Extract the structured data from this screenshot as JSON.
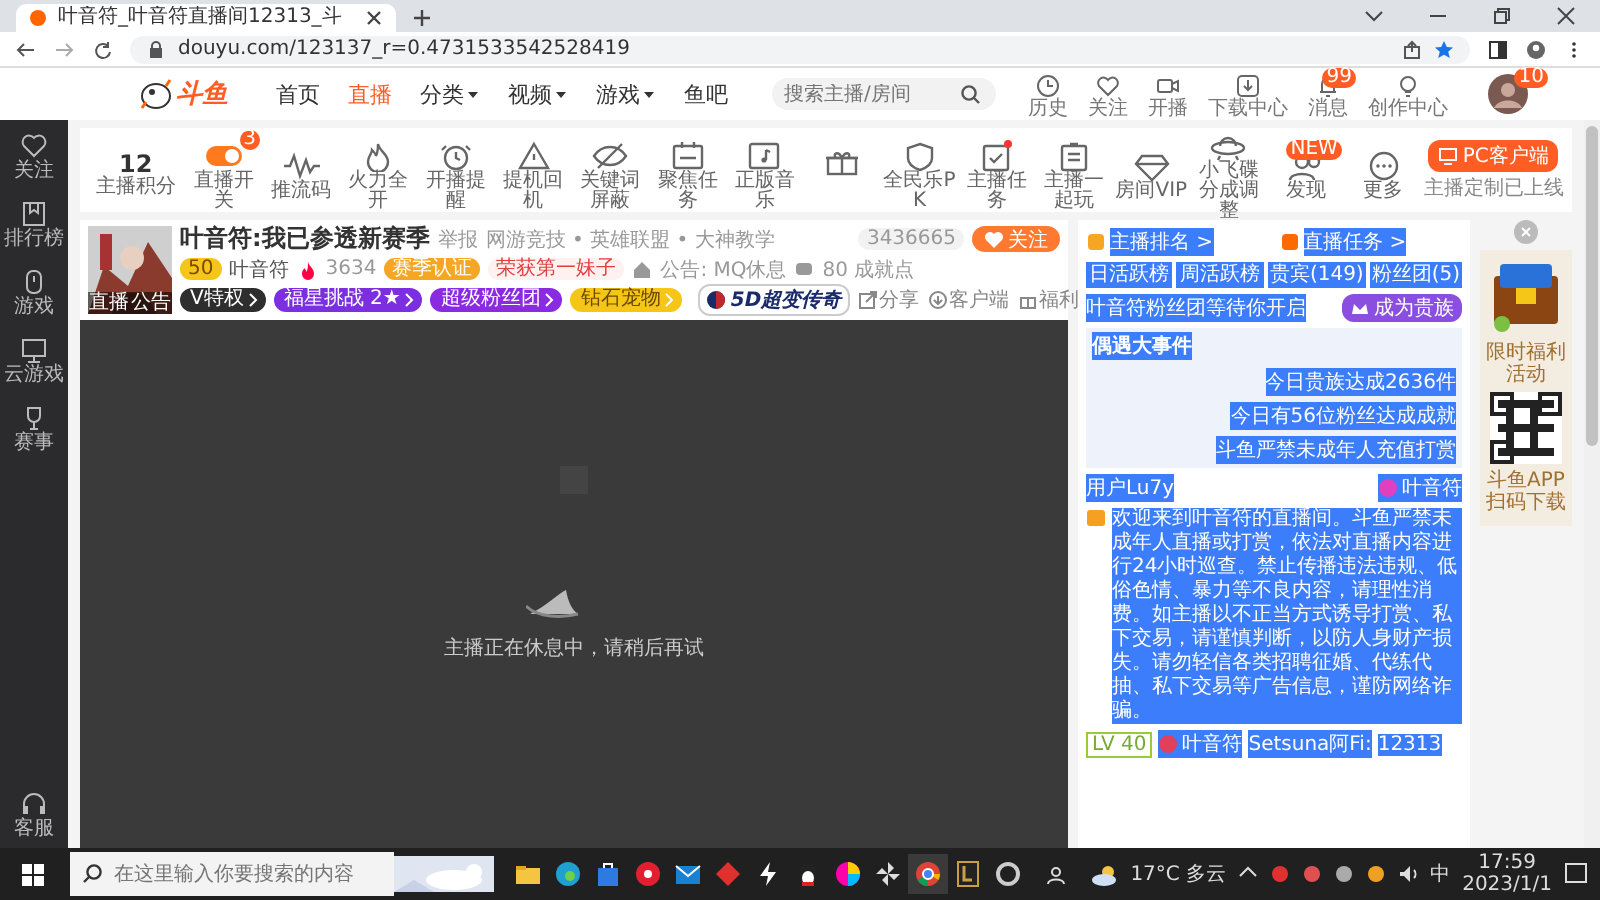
{
  "browser": {
    "tab_title": "叶音符_叶音符直播间12313_斗",
    "url": "douyu.com/123137_r=0.4731533542528419"
  },
  "site_nav": {
    "logo": "斗鱼",
    "items": [
      {
        "label": "首页",
        "selected": false,
        "dropdown": false
      },
      {
        "label": "直播",
        "selected": true,
        "dropdown": false
      },
      {
        "label": "分类",
        "selected": false,
        "dropdown": true
      },
      {
        "label": "视频",
        "selected": false,
        "dropdown": true
      },
      {
        "label": "游戏",
        "selected": false,
        "dropdown": true
      },
      {
        "label": "鱼吧",
        "selected": false,
        "dropdown": false
      }
    ],
    "search": {
      "placeholder": "搜索主播/房间"
    },
    "actions": [
      {
        "label": "历史"
      },
      {
        "label": "关注"
      },
      {
        "label": "开播"
      },
      {
        "label": "下载中心"
      },
      {
        "label": "消息",
        "badge": "99"
      },
      {
        "label": "创作中心"
      }
    ],
    "avatar_badge": "10"
  },
  "sidebar": {
    "items": [
      {
        "label": "关注"
      },
      {
        "label": "排行榜"
      },
      {
        "label": "游戏"
      },
      {
        "label": "云游戏"
      },
      {
        "label": "赛事"
      }
    ],
    "bottom": "客服"
  },
  "toolbar": {
    "score": "12",
    "score_label": "主播积分",
    "items": [
      {
        "kind": "labeled",
        "label": "直播开关",
        "badge": "3"
      },
      {
        "kind": "labeled",
        "label": "推流码"
      },
      {
        "kind": "labeled",
        "label": "火力全开"
      },
      {
        "kind": "labeled",
        "label": "开播提醒"
      },
      {
        "kind": "labeled",
        "label": "提机回机"
      },
      {
        "kind": "labeled",
        "label": "关键词屏蔽"
      },
      {
        "kind": "labeled",
        "label": "聚焦任务"
      },
      {
        "kind": "labeled",
        "label": "正版音乐"
      },
      {
        "kind": "icon"
      },
      {
        "kind": "labeled",
        "label": "全民乐PK"
      },
      {
        "kind": "labeled",
        "label": "主播任务",
        "dot": true
      },
      {
        "kind": "labeled",
        "label": "主播一起玩"
      },
      {
        "kind": "labeled",
        "label": "房间VIP"
      },
      {
        "kind": "labeled",
        "label": "小飞碟分成调整"
      },
      {
        "kind": "labeled",
        "label": "发现",
        "badge": "NEW"
      },
      {
        "kind": "labeled",
        "label": "更多"
      }
    ],
    "pc_button": "PC客户端",
    "pc_note": "主播定制已上线"
  },
  "streamer": {
    "avatar_tabs": [
      "直播",
      "公告"
    ],
    "title": "叶音符:我已参透新赛季",
    "report": "举报",
    "category": "网游竞技 • 英雄联盟 • 大神教学",
    "followers": "3436665",
    "follow_button": "关注",
    "level": "50",
    "name": "叶音符",
    "heat": "3634",
    "honor": "赛季认证",
    "award": "荣获第一妹子",
    "notice": "公告: MQ休息",
    "achievements": "80 成就点",
    "tags": [
      {
        "label": "V特权",
        "color": "#2e2e2e"
      },
      {
        "label": "福星挑战 2★",
        "color": "#7b2fe0"
      },
      {
        "label": "超级粉丝团",
        "color": "#8a2be2"
      },
      {
        "label": "钻石宠物",
        "color": "#f5c518"
      }
    ],
    "ad": "5D超变传奇",
    "actions": [
      "分享",
      "客户端",
      "福利"
    ]
  },
  "video": {
    "message": "主播正在休息中，请稍后再试"
  },
  "chat": {
    "links": [
      "主播排名 >",
      "直播任务 >"
    ],
    "tabs": [
      {
        "label": "日活跃榜",
        "selected": false
      },
      {
        "label": "周活跃榜",
        "selected": false
      },
      {
        "label": "贵宾(149)",
        "selected": false
      },
      {
        "label": "粉丝团(5)",
        "selected": false
      }
    ],
    "fan_club": {
      "text": "叶音符粉丝团等待你开启",
      "button": "成为贵族"
    },
    "event": {
      "title": "偶遇大事件",
      "lines": [
        "今日贵族达成2636件",
        "今日有56位粉丝达成成就",
        "斗鱼严禁未成年人充值打赏"
      ]
    },
    "entry_user": "用户Lu7y",
    "host_tag": "叶音符",
    "welcome": "欢迎来到叶音符的直播间。斗鱼严禁未成年人直播或打赏，依法对直播内容进行24小时巡查。禁止传播违法违规、低俗色情、暴力等不良内容，请理性消费。如主播以不正当方式诱导打赏、私下交易，请谨慎判断，以防人身财产损失。请勿轻信各类招聘征婚、代练代抽、私下交易等广告信息，谨防网络诈骗。",
    "last": {
      "level": "LV 40",
      "user": "叶音符",
      "sender": "Setsuna阿Fi:",
      "text": "12313"
    }
  },
  "ad_panel": {
    "caption": "限时福利活动",
    "qr_caption": "斗鱼APP扫码下载"
  },
  "taskbar": {
    "search": {
      "placeholder": "在这里输入你要搜索的内容"
    },
    "weather": "17°C 多云",
    "ime": "中",
    "time": "17:59",
    "date": "2023/1/1"
  }
}
